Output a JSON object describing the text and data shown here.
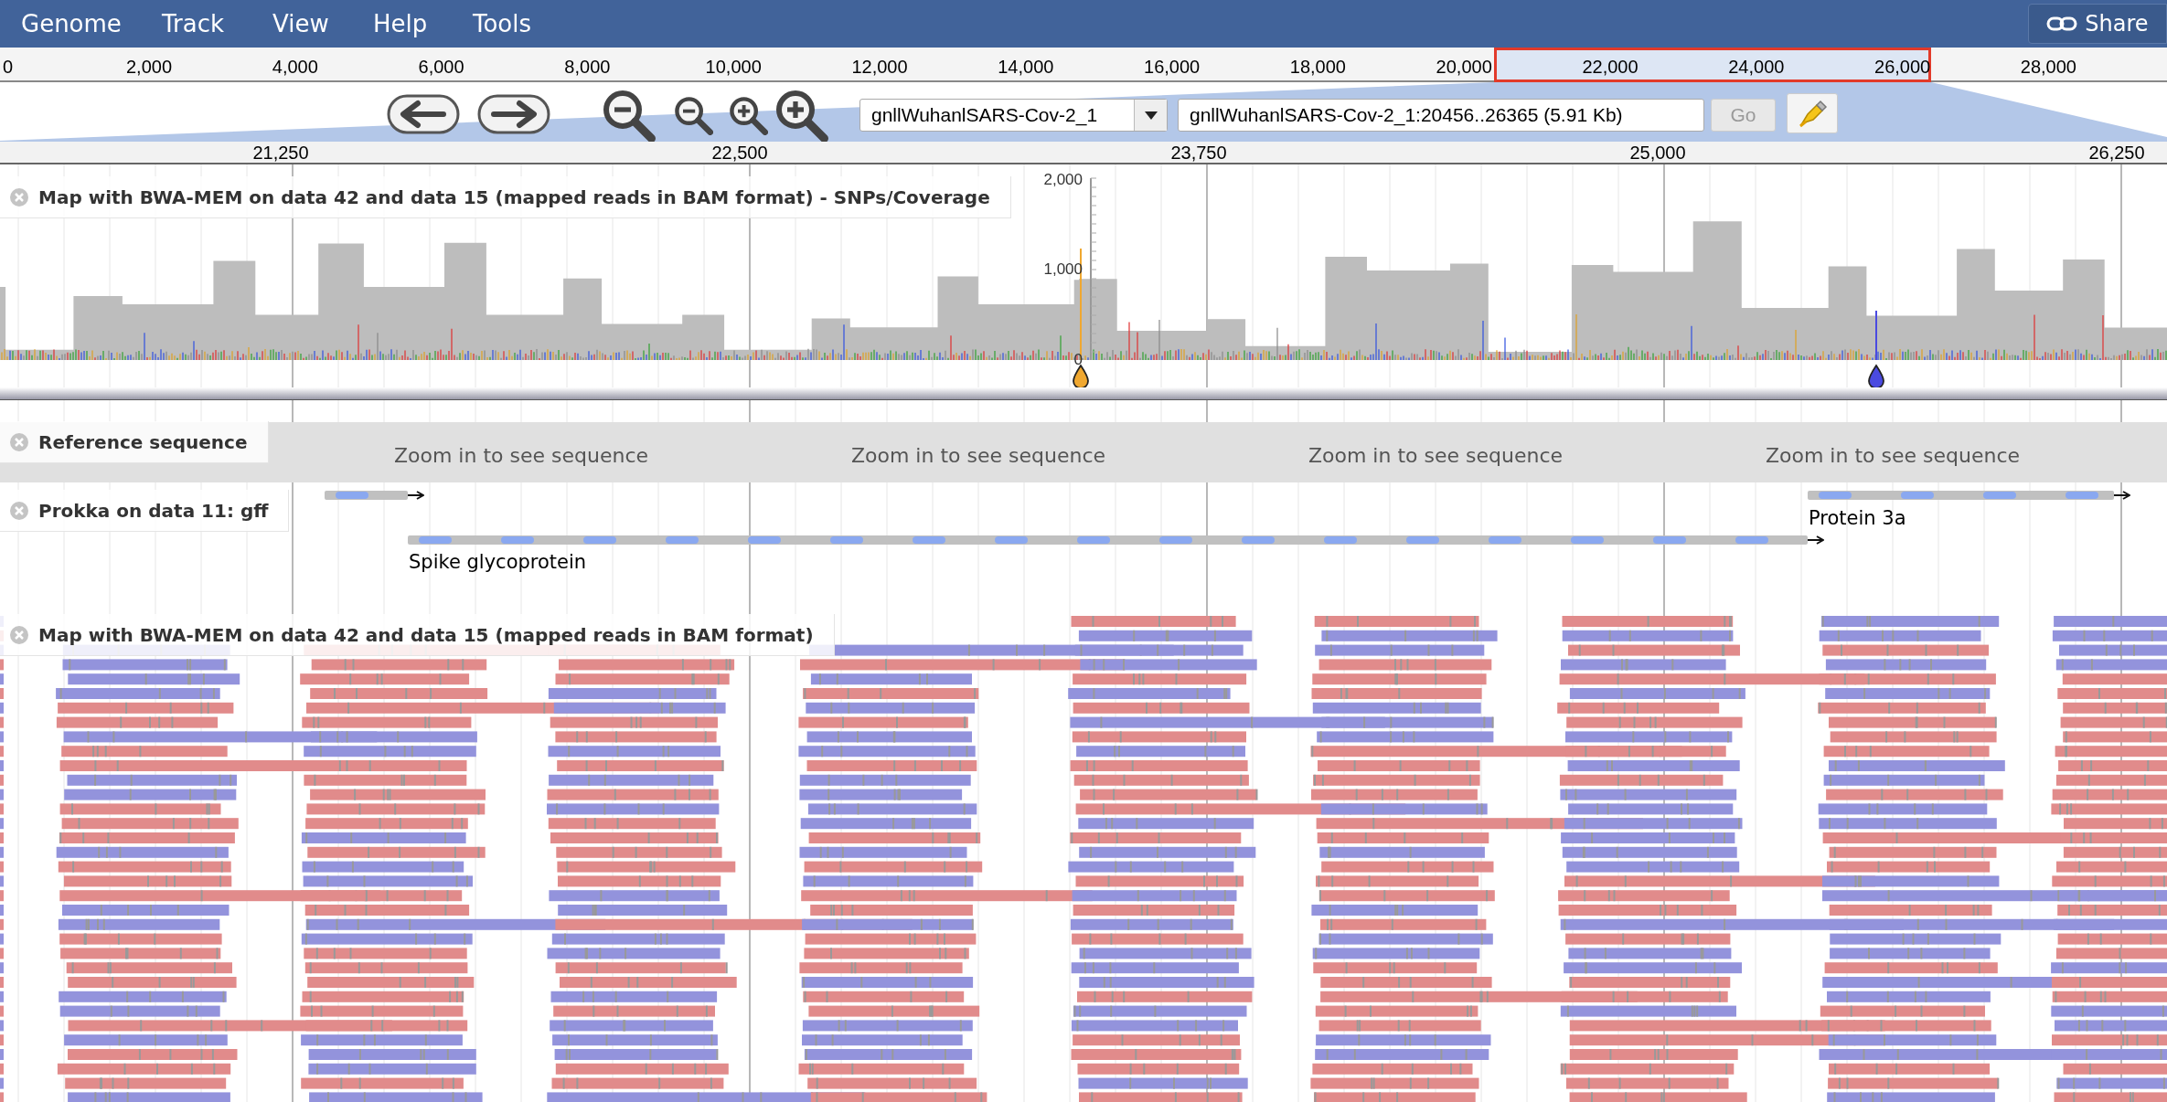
{
  "menu": [
    {
      "label": "Genome"
    },
    {
      "label": "Track"
    },
    {
      "label": "View"
    },
    {
      "label": "Help"
    },
    {
      "label": "Tools"
    }
  ],
  "share_button": {
    "label": "Share"
  },
  "overview_ruler": {
    "ticks": [
      "0",
      "2,000",
      "4,000",
      "6,000",
      "8,000",
      "10,000",
      "12,000",
      "14,000",
      "16,000",
      "18,000",
      "20,000",
      "22,000",
      "24,000",
      "26,000",
      "28,000"
    ]
  },
  "navigation": {
    "reference_select": {
      "value": "gnllWuhanlSARS-Cov-2_1"
    },
    "location_field": {
      "value": "gnllWuhanlSARS-Cov-2_1:20456..26365 (5.91 Kb)"
    },
    "go_button": {
      "label": "Go",
      "disabled": true
    }
  },
  "detail_ruler": {
    "ticks": [
      "21,250",
      "22,500",
      "23,750",
      "25,000",
      "26,250"
    ]
  },
  "tracks": [
    {
      "kind": "coverage",
      "label": "Map with BWA-MEM on data 42 and data 15 (mapped reads in BAM format) - SNPs/Coverage",
      "axis_ticks": [
        "2,000",
        "1,000",
        "0"
      ],
      "markers": [
        {
          "color": "#f0a830"
        },
        {
          "color": "#4a4ae0"
        }
      ]
    },
    {
      "kind": "sequence",
      "label": "Reference sequence",
      "messages": [
        "Zoom in to see sequence",
        "Zoom in to see sequence",
        "Zoom in to see sequence",
        "Zoom in to see sequence"
      ]
    },
    {
      "kind": "features",
      "label": "Prokka on data 11: gff",
      "features": [
        {
          "name": "Protein 3a"
        },
        {
          "name": "Spike glycoprotein"
        }
      ]
    },
    {
      "kind": "alignments",
      "label": "Map with BWA-MEM on data 42 and data 15 (mapped reads in BAM format)"
    }
  ]
}
